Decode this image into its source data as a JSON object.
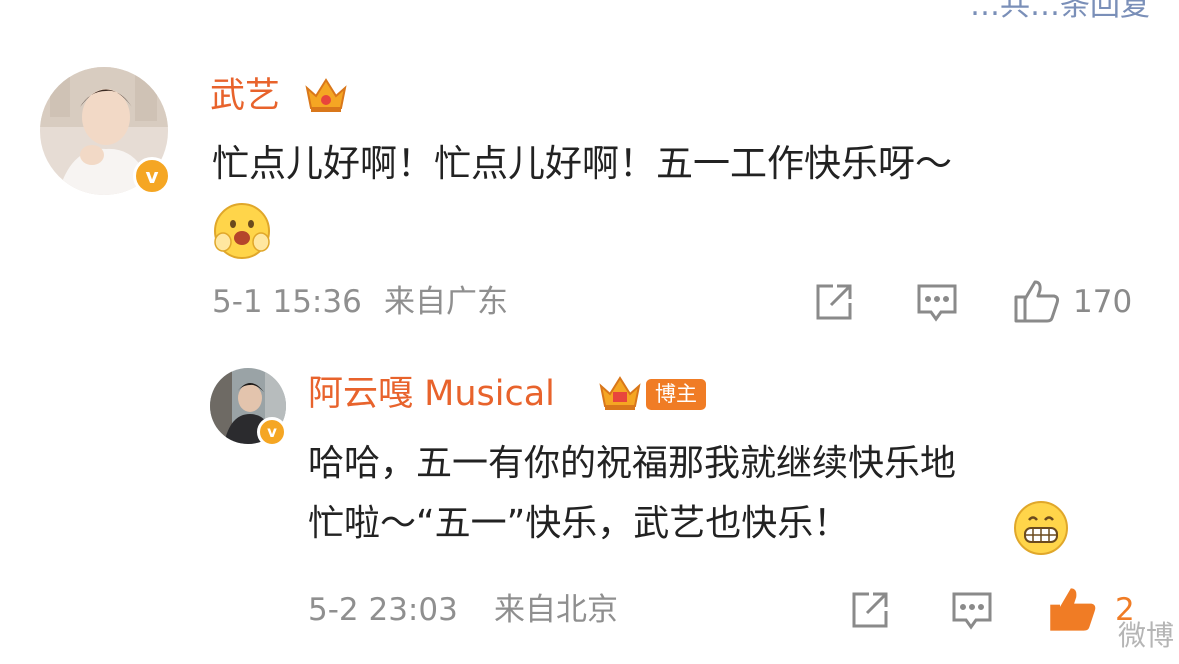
{
  "colors": {
    "name": "#e8632c",
    "text": "#222222",
    "meta": "#8f8f8f",
    "icon": "#8a8a8a",
    "accent": "#f07c25"
  },
  "header": {
    "top_partial_text": "…共…条回复"
  },
  "comment": {
    "author": "武艺",
    "text": "忙点儿好啊！忙点儿好啊！五一工作快乐呀～",
    "emoji": "happy-blush-emoji",
    "time": "5-1 15:36",
    "location": "来自广东",
    "like_count": "170"
  },
  "reply": {
    "author": "阿云嘎 Musical",
    "badge": "博主",
    "text_line1": "哈哈，五一有你的祝福那我就继续快乐地",
    "text_line2": "忙啦～“五一”快乐，武艺也快乐！",
    "emoji": "grin-emoji",
    "time": "5-2 23:03",
    "location": "来自北京",
    "like_count": "2"
  },
  "watermark": "微博"
}
